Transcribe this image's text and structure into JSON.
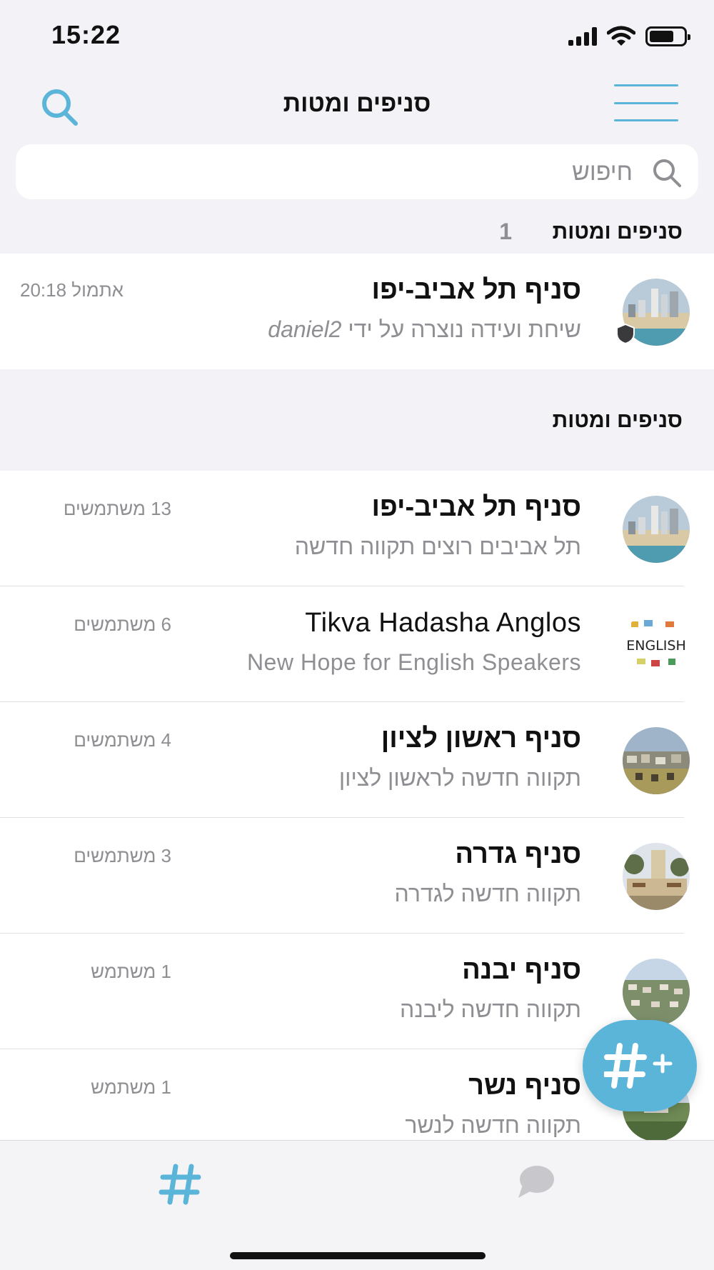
{
  "status_bar": {
    "time": "15:22"
  },
  "nav": {
    "title": "סניפים ומטות"
  },
  "search": {
    "placeholder": "חיפוש"
  },
  "pinned_section": {
    "label": "סניפים ומטות",
    "count": "1",
    "item": {
      "title": "סניף תל אביב-יפו",
      "subtitle_prefix": "שיחת ועידה נוצרה על ידי ",
      "subtitle_user": "daniel2",
      "time": "אתמול 20:18"
    }
  },
  "channels_section": {
    "label": "סניפים ומטות"
  },
  "channels": [
    {
      "title": "סניף תל אביב-יפו",
      "subtitle": "תל אביבים רוצים תקווה חדשה",
      "members": "13 משתמשים",
      "avatar": "beach-city"
    },
    {
      "title": "Tikva Hadasha Anglos",
      "subtitle": "New Hope for English Speakers",
      "members": "6 משתמשים",
      "avatar": "english"
    },
    {
      "title": "סניף ראשון לציון",
      "subtitle": "תקווה חדשה לראשון לציון",
      "members": "4 משתמשים",
      "avatar": "city-aerial"
    },
    {
      "title": "סניף גדרה",
      "subtitle": "תקווה חדשה לגדרה",
      "members": "3 משתמשים",
      "avatar": "town-sign"
    },
    {
      "title": "סניף יבנה",
      "subtitle": "תקווה חדשה ליבנה",
      "members": "1 משתמש",
      "avatar": "town-aerial"
    },
    {
      "title": "סניף נשר",
      "subtitle": "תקווה חדשה לנשר",
      "members": "1 משתמש",
      "avatar": "hills"
    }
  ],
  "colors": {
    "accent": "#5bb5d9",
    "secondary_text": "#8e8e93",
    "background": "#f2f2f7"
  }
}
